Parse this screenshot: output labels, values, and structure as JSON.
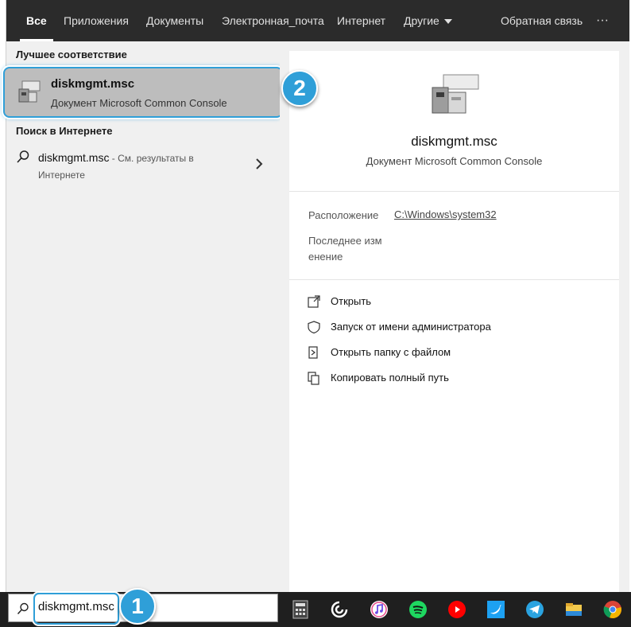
{
  "tabs": {
    "all": "Все",
    "apps": "Приложения",
    "docs": "Документы",
    "email": "Электронная_почта",
    "web": "Интернет",
    "more": "Другие",
    "feedback": "Обратная связь",
    "overflow": "···"
  },
  "results": {
    "best_match_title": "Лучшее соответствие",
    "best_match": {
      "name": "diskmgmt.msc",
      "description": "Документ Microsoft Common Console",
      "icon": "mmc-console-icon"
    },
    "web_section_title": "Поиск в Интернете",
    "web_result": {
      "query": "diskmgmt.msc",
      "suffix": " - См. результаты в",
      "suffix2": "Интернете",
      "icon": "search-icon"
    }
  },
  "details": {
    "name": "diskmgmt.msc",
    "type": "Документ Microsoft Common Console",
    "location_label": "Расположение",
    "location_value": "C:\\Windows\\system32",
    "modified_label_1": "Последнее изм",
    "modified_label_2": "енение",
    "actions": [
      {
        "label": "Открыть",
        "icon": "open-icon"
      },
      {
        "label": "Запуск от имени администратора",
        "icon": "shield-icon"
      },
      {
        "label": "Открыть папку с файлом",
        "icon": "folder-icon"
      },
      {
        "label": "Копировать полный путь",
        "icon": "copy-icon"
      }
    ]
  },
  "taskbar": {
    "search_value": "diskmgmt.msc",
    "apps": [
      "calculator-icon",
      "cortana-icon",
      "itunes-icon",
      "spotify-icon",
      "youtube-icon",
      "twitter-icon",
      "telegram-icon",
      "file-explorer-icon",
      "chrome-icon"
    ]
  },
  "annotations": {
    "badge_1": "1",
    "badge_2": "2"
  },
  "colors": {
    "accent": "#2f9fd8",
    "topbar": "#2b2b2b",
    "panel": "#f0f0f0",
    "selection": "#bdbdbd",
    "taskbar": "#1f1f1f"
  }
}
